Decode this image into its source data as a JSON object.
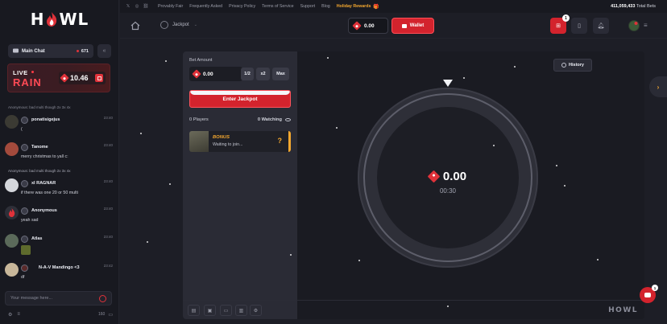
{
  "brand": {
    "logo_text_left": "H",
    "logo_text_right": "WL"
  },
  "topstrip": {
    "links": [
      "Provably Fair",
      "Frequently Asked",
      "Privacy Policy",
      "Terms of Service",
      "Support",
      "Blog"
    ],
    "highlight_link": "Holiday Rewards",
    "total_bets_value": "411,059,433",
    "total_bets_label": "Total Bets"
  },
  "navbar": {
    "game_name": "Jackpot",
    "balance": "0.00",
    "wallet_label": "Wallet",
    "gift_badge": "1"
  },
  "chat": {
    "title": "Main Chat",
    "online_count": "671",
    "rain": {
      "live_label": "LIVE",
      "rain_label": "RAIN",
      "amount": "10.46"
    },
    "system_messages": [
      "Anonymous: bad multi though 2x 3x 4x",
      "Anonymous: bad multi though 2x 3x 4x"
    ],
    "messages": [
      {
        "user": "ponatisigejus",
        "time": "23:40",
        "text": "("
      },
      {
        "user": "Tanome",
        "time": "23:40",
        "text": "merry christmas to yall c:"
      },
      {
        "user": "xl RAGNAR",
        "time": "23:40",
        "text": "if there was one 20 or 50 multi"
      },
      {
        "user": "Anonymous",
        "time": "23:40",
        "text": "yeah sad"
      },
      {
        "user": "Atlas",
        "time": "23:40",
        "text": ""
      },
      {
        "user": "N-A-V Mandingo <3",
        "time": "23:42",
        "text": "df"
      }
    ],
    "input_placeholder": "Your message here...",
    "char_count": "160"
  },
  "game": {
    "bet_label": "Bet Amount",
    "bet_value": "0.00",
    "half_label": "1/2",
    "double_label": "x2",
    "max_label": "Max",
    "enter_label": "Enter Jackpot",
    "players_label": "0 Players",
    "watching_label": "0 Watching",
    "bonus_title": "BONUS",
    "bonus_sub": "Waiting to join...",
    "bonus_mark": "?",
    "history_label": "History",
    "pot_value": "0.00",
    "timer": "00:30",
    "watermark": "HOWL"
  },
  "support": {
    "badge": "1"
  },
  "colors": {
    "accent": "#d3232d",
    "gold": "#f3a72f",
    "bg": "#1d1e26"
  }
}
